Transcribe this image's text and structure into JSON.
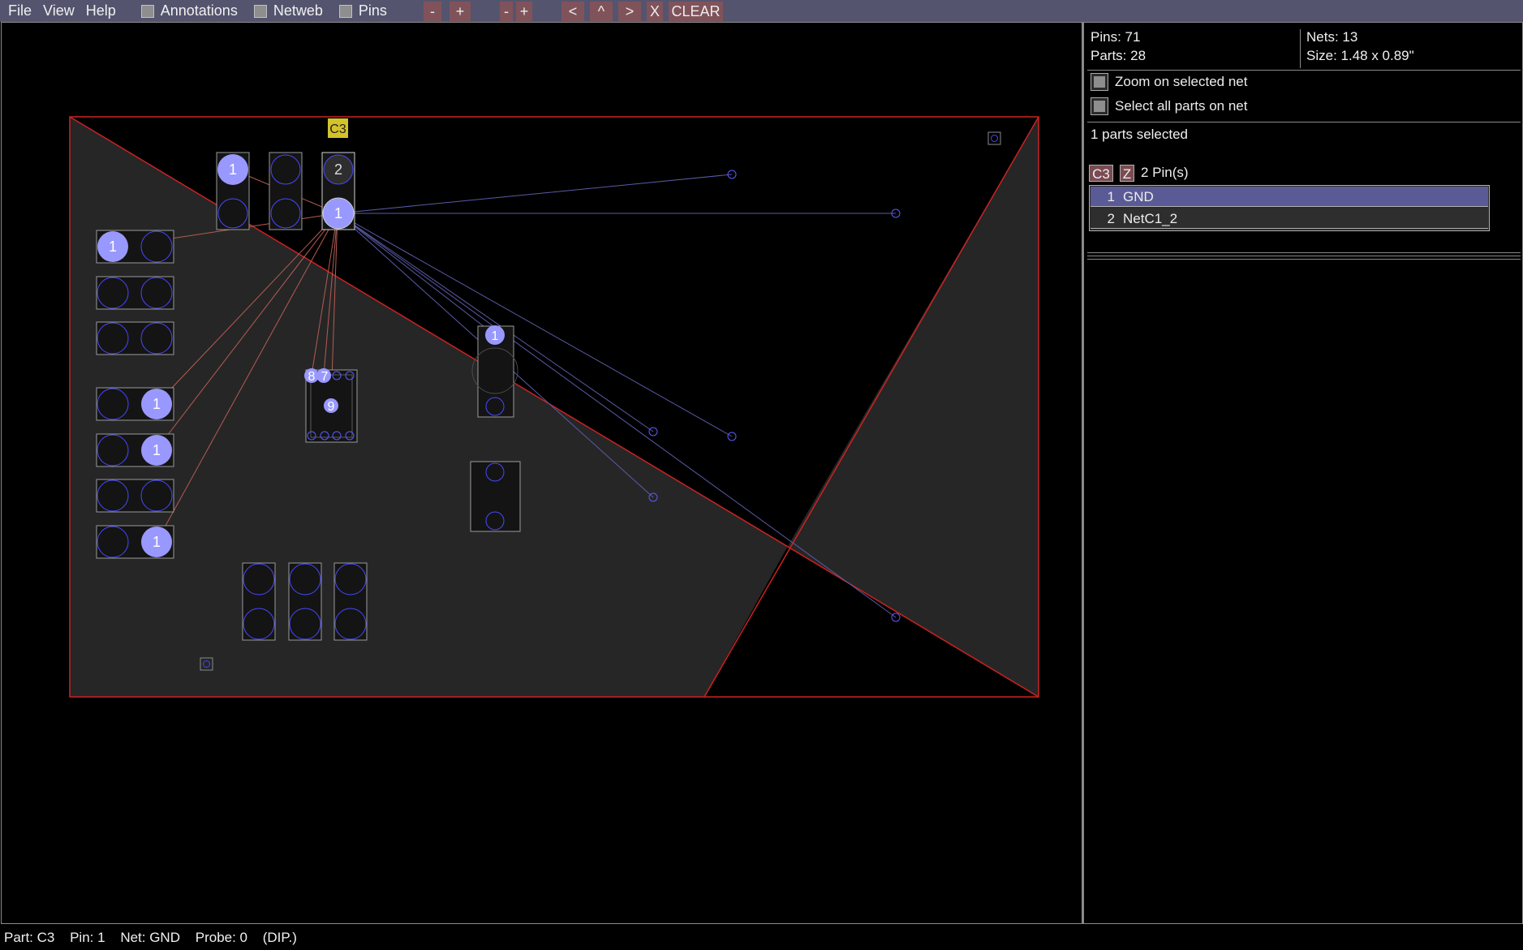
{
  "menu": {
    "file": "File",
    "view": "View",
    "help": "Help"
  },
  "toggles": {
    "annotations": "Annotations",
    "netweb": "Netweb",
    "pins": "Pins"
  },
  "toolbar": {
    "zoom_out_1": "-",
    "zoom_in_1": "+",
    "zoom_out_2": "-",
    "zoom_in_2": "+",
    "prev": "<",
    "up": "^",
    "next": ">",
    "close": "X",
    "clear": "CLEAR"
  },
  "stats": {
    "pins": "Pins: 71",
    "parts": "Parts: 28",
    "nets": "Nets: 13",
    "size": "Size: 1.48 x 0.89\""
  },
  "options": {
    "zoom_on_net": "Zoom on selected net",
    "select_all_parts": "Select all parts on net"
  },
  "selection": {
    "count": "1 parts selected",
    "part_tag": "C3",
    "side_tag": "Z",
    "pin_count": "2 Pin(s)"
  },
  "pin_list": [
    {
      "num": "1",
      "net": "GND",
      "selected": true
    },
    {
      "num": "2",
      "net": "NetC1_2",
      "selected": false
    }
  ],
  "board": {
    "label_c3": "C3",
    "pin_labels": {
      "one": "1",
      "two": "2",
      "seven": "7",
      "eight": "8",
      "nine": "9"
    }
  },
  "status": {
    "part": "Part: C3",
    "pin": "Pin: 1",
    "net": "Net: GND",
    "probe": "Probe: 0",
    "type": "(DIP.)"
  },
  "colors": {
    "menubar": "#54546f",
    "button": "#80535a",
    "selected_row": "#5a5a96",
    "pin_fill": "#9898ff",
    "outline": "#cc2222",
    "part_label": "#d4c22a"
  }
}
